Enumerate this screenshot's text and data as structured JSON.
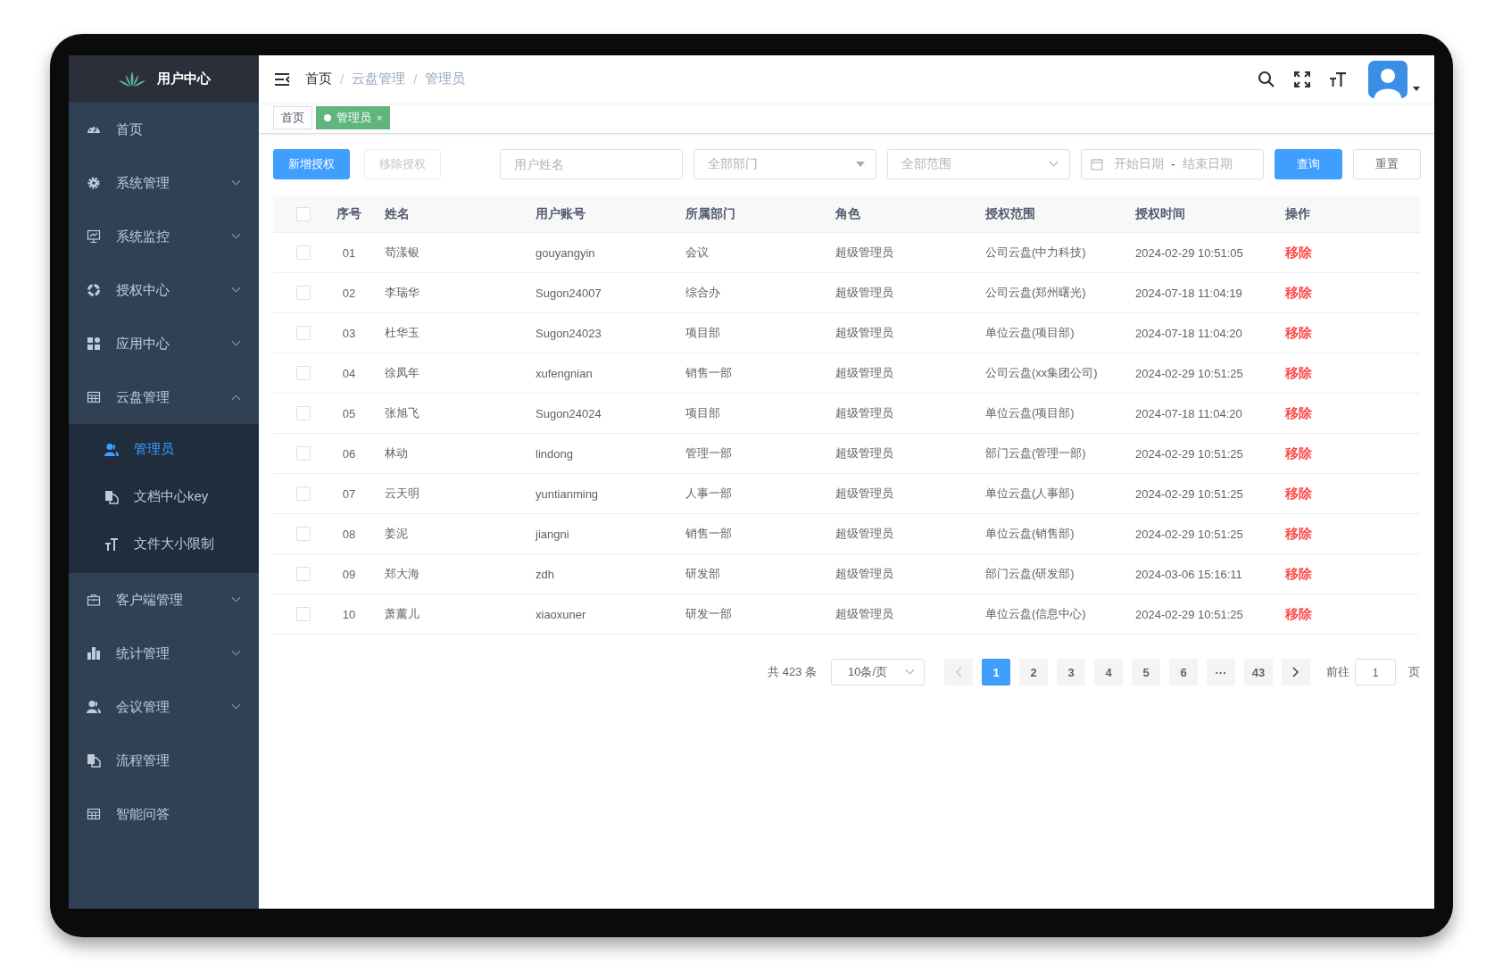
{
  "sidebar": {
    "title": "用户中心",
    "items": [
      {
        "label": "首页",
        "kind": "link",
        "selected": false
      },
      {
        "label": "系统管理",
        "kind": "submenu",
        "expanded": false
      },
      {
        "label": "系统监控",
        "kind": "submenu",
        "expanded": false
      },
      {
        "label": "授权中心",
        "kind": "submenu",
        "expanded": false
      },
      {
        "label": "应用中心",
        "kind": "submenu",
        "expanded": false
      },
      {
        "label": "云盘管理",
        "kind": "submenu",
        "expanded": true,
        "children": [
          {
            "label": "管理员",
            "selected": true
          },
          {
            "label": "文档中心key",
            "selected": false
          },
          {
            "label": "文件大小限制",
            "selected": false
          }
        ]
      },
      {
        "label": "客户端管理",
        "kind": "submenu",
        "expanded": false
      },
      {
        "label": "统计管理",
        "kind": "submenu",
        "expanded": false
      },
      {
        "label": "会议管理",
        "kind": "submenu",
        "expanded": false
      },
      {
        "label": "流程管理",
        "kind": "link",
        "selected": false
      },
      {
        "label": "智能问答",
        "kind": "link",
        "selected": false
      }
    ]
  },
  "breadcrumb": [
    "首页",
    "云盘管理",
    "管理员"
  ],
  "breadcrumb_separator": "/",
  "tabs": [
    {
      "label": "首页",
      "selected": false
    },
    {
      "label": "管理员",
      "selected": true,
      "close": "×"
    }
  ],
  "toolbar": {
    "buttons": [
      {
        "label": "新增授权",
        "kind": "primary",
        "disabled": false
      },
      {
        "label": "移除授权",
        "kind": "default",
        "disabled": true
      }
    ],
    "name_placeholder": "用户姓名",
    "department_placeholder": "全部部门",
    "scope_placeholder": "全部范围",
    "date_range": {
      "start_placeholder": "开始日期",
      "separator": "-",
      "end_placeholder": "结束日期"
    },
    "search_button": "查询",
    "reset_button": "重置"
  },
  "table": {
    "all_checked": false,
    "columns": [
      "序号",
      "姓名",
      "用户账号",
      "所属部门",
      "角色",
      "授权范围",
      "授权时间",
      "操作"
    ],
    "rows": [
      {
        "checked": false,
        "no": "01",
        "name": "苟漾银",
        "account": "gouyangyin",
        "department": "会议",
        "role": "超级管理员",
        "scope": "公司云盘(中力科技)",
        "time": "2024-02-29 10:51:05",
        "action": "移除"
      },
      {
        "checked": false,
        "no": "02",
        "name": "李瑞华",
        "account": "Sugon24007",
        "department": "综合办",
        "role": "超级管理员",
        "scope": "公司云盘(郑州曙光)",
        "time": "2024-07-18 11:04:19",
        "action": "移除"
      },
      {
        "checked": false,
        "no": "03",
        "name": "杜华玉",
        "account": "Sugon24023",
        "department": "项目部",
        "role": "超级管理员",
        "scope": "单位云盘(项目部)",
        "time": "2024-07-18 11:04:20",
        "action": "移除"
      },
      {
        "checked": false,
        "no": "04",
        "name": "徐凤年",
        "account": "xufengnian",
        "department": "销售一部",
        "role": "超级管理员",
        "scope": "公司云盘(xx集团公司)",
        "time": "2024-02-29 10:51:25",
        "action": "移除"
      },
      {
        "checked": false,
        "no": "05",
        "name": "张旭飞",
        "account": "Sugon24024",
        "department": "项目部",
        "role": "超级管理员",
        "scope": "单位云盘(项目部)",
        "time": "2024-07-18 11:04:20",
        "action": "移除"
      },
      {
        "checked": false,
        "no": "06",
        "name": "林动",
        "account": "lindong",
        "department": "管理一部",
        "role": "超级管理员",
        "scope": "部门云盘(管理一部)",
        "time": "2024-02-29 10:51:25",
        "action": "移除"
      },
      {
        "checked": false,
        "no": "07",
        "name": "云天明",
        "account": "yuntianming",
        "department": "人事一部",
        "role": "超级管理员",
        "scope": "单位云盘(人事部)",
        "time": "2024-02-29 10:51:25",
        "action": "移除"
      },
      {
        "checked": false,
        "no": "08",
        "name": "姜泥",
        "account": "jiangni",
        "department": "销售一部",
        "role": "超级管理员",
        "scope": "单位云盘(销售部)",
        "time": "2024-02-29 10:51:25",
        "action": "移除"
      },
      {
        "checked": false,
        "no": "09",
        "name": "郑大海",
        "account": "zdh",
        "department": "研发部",
        "role": "超级管理员",
        "scope": "部门云盘(研发部)",
        "time": "2024-03-06 15:16:11",
        "action": "移除"
      },
      {
        "checked": false,
        "no": "10",
        "name": "萧薰儿",
        "account": "xiaoxuner",
        "department": "研发一部",
        "role": "超级管理员",
        "scope": "单位云盘(信息中心)",
        "time": "2024-02-29 10:51:25",
        "action": "移除"
      }
    ]
  },
  "pagination": {
    "total": "共 423 条",
    "page_size": "10条/页",
    "prev_disabled": true,
    "next_disabled": false,
    "pages": [
      {
        "label": "1",
        "selected": true
      },
      {
        "label": "2",
        "selected": false
      },
      {
        "label": "3",
        "selected": false
      },
      {
        "label": "4",
        "selected": false
      },
      {
        "label": "5",
        "selected": false
      },
      {
        "label": "6",
        "selected": false
      },
      {
        "label": "···",
        "selected": false
      },
      {
        "label": "43",
        "selected": false
      }
    ],
    "goto_label": "前往",
    "goto_value": "1",
    "goto_suffix": "页"
  }
}
